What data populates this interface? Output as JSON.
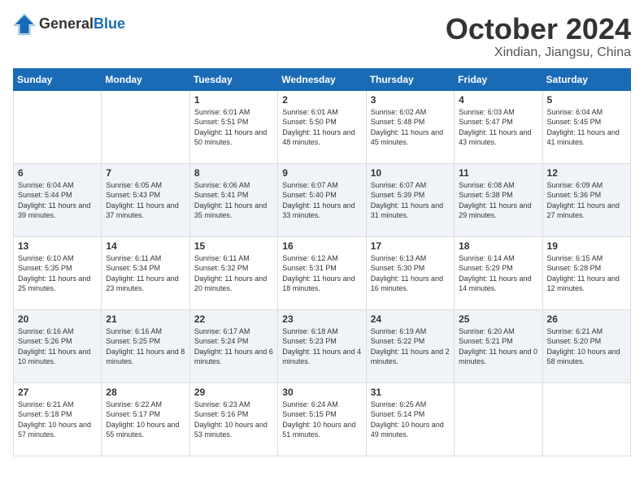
{
  "header": {
    "logo_general": "General",
    "logo_blue": "Blue",
    "month_title": "October 2024",
    "location": "Xindian, Jiangsu, China"
  },
  "weekdays": [
    "Sunday",
    "Monday",
    "Tuesday",
    "Wednesday",
    "Thursday",
    "Friday",
    "Saturday"
  ],
  "weeks": [
    [
      {
        "day": "",
        "sunrise": "",
        "sunset": "",
        "daylight": ""
      },
      {
        "day": "",
        "sunrise": "",
        "sunset": "",
        "daylight": ""
      },
      {
        "day": "1",
        "sunrise": "Sunrise: 6:01 AM",
        "sunset": "Sunset: 5:51 PM",
        "daylight": "Daylight: 11 hours and 50 minutes."
      },
      {
        "day": "2",
        "sunrise": "Sunrise: 6:01 AM",
        "sunset": "Sunset: 5:50 PM",
        "daylight": "Daylight: 11 hours and 48 minutes."
      },
      {
        "day": "3",
        "sunrise": "Sunrise: 6:02 AM",
        "sunset": "Sunset: 5:48 PM",
        "daylight": "Daylight: 11 hours and 45 minutes."
      },
      {
        "day": "4",
        "sunrise": "Sunrise: 6:03 AM",
        "sunset": "Sunset: 5:47 PM",
        "daylight": "Daylight: 11 hours and 43 minutes."
      },
      {
        "day": "5",
        "sunrise": "Sunrise: 6:04 AM",
        "sunset": "Sunset: 5:45 PM",
        "daylight": "Daylight: 11 hours and 41 minutes."
      }
    ],
    [
      {
        "day": "6",
        "sunrise": "Sunrise: 6:04 AM",
        "sunset": "Sunset: 5:44 PM",
        "daylight": "Daylight: 11 hours and 39 minutes."
      },
      {
        "day": "7",
        "sunrise": "Sunrise: 6:05 AM",
        "sunset": "Sunset: 5:43 PM",
        "daylight": "Daylight: 11 hours and 37 minutes."
      },
      {
        "day": "8",
        "sunrise": "Sunrise: 6:06 AM",
        "sunset": "Sunset: 5:41 PM",
        "daylight": "Daylight: 11 hours and 35 minutes."
      },
      {
        "day": "9",
        "sunrise": "Sunrise: 6:07 AM",
        "sunset": "Sunset: 5:40 PM",
        "daylight": "Daylight: 11 hours and 33 minutes."
      },
      {
        "day": "10",
        "sunrise": "Sunrise: 6:07 AM",
        "sunset": "Sunset: 5:39 PM",
        "daylight": "Daylight: 11 hours and 31 minutes."
      },
      {
        "day": "11",
        "sunrise": "Sunrise: 6:08 AM",
        "sunset": "Sunset: 5:38 PM",
        "daylight": "Daylight: 11 hours and 29 minutes."
      },
      {
        "day": "12",
        "sunrise": "Sunrise: 6:09 AM",
        "sunset": "Sunset: 5:36 PM",
        "daylight": "Daylight: 11 hours and 27 minutes."
      }
    ],
    [
      {
        "day": "13",
        "sunrise": "Sunrise: 6:10 AM",
        "sunset": "Sunset: 5:35 PM",
        "daylight": "Daylight: 11 hours and 25 minutes."
      },
      {
        "day": "14",
        "sunrise": "Sunrise: 6:11 AM",
        "sunset": "Sunset: 5:34 PM",
        "daylight": "Daylight: 11 hours and 23 minutes."
      },
      {
        "day": "15",
        "sunrise": "Sunrise: 6:11 AM",
        "sunset": "Sunset: 5:32 PM",
        "daylight": "Daylight: 11 hours and 20 minutes."
      },
      {
        "day": "16",
        "sunrise": "Sunrise: 6:12 AM",
        "sunset": "Sunset: 5:31 PM",
        "daylight": "Daylight: 11 hours and 18 minutes."
      },
      {
        "day": "17",
        "sunrise": "Sunrise: 6:13 AM",
        "sunset": "Sunset: 5:30 PM",
        "daylight": "Daylight: 11 hours and 16 minutes."
      },
      {
        "day": "18",
        "sunrise": "Sunrise: 6:14 AM",
        "sunset": "Sunset: 5:29 PM",
        "daylight": "Daylight: 11 hours and 14 minutes."
      },
      {
        "day": "19",
        "sunrise": "Sunrise: 6:15 AM",
        "sunset": "Sunset: 5:28 PM",
        "daylight": "Daylight: 11 hours and 12 minutes."
      }
    ],
    [
      {
        "day": "20",
        "sunrise": "Sunrise: 6:16 AM",
        "sunset": "Sunset: 5:26 PM",
        "daylight": "Daylight: 11 hours and 10 minutes."
      },
      {
        "day": "21",
        "sunrise": "Sunrise: 6:16 AM",
        "sunset": "Sunset: 5:25 PM",
        "daylight": "Daylight: 11 hours and 8 minutes."
      },
      {
        "day": "22",
        "sunrise": "Sunrise: 6:17 AM",
        "sunset": "Sunset: 5:24 PM",
        "daylight": "Daylight: 11 hours and 6 minutes."
      },
      {
        "day": "23",
        "sunrise": "Sunrise: 6:18 AM",
        "sunset": "Sunset: 5:23 PM",
        "daylight": "Daylight: 11 hours and 4 minutes."
      },
      {
        "day": "24",
        "sunrise": "Sunrise: 6:19 AM",
        "sunset": "Sunset: 5:22 PM",
        "daylight": "Daylight: 11 hours and 2 minutes."
      },
      {
        "day": "25",
        "sunrise": "Sunrise: 6:20 AM",
        "sunset": "Sunset: 5:21 PM",
        "daylight": "Daylight: 11 hours and 0 minutes."
      },
      {
        "day": "26",
        "sunrise": "Sunrise: 6:21 AM",
        "sunset": "Sunset: 5:20 PM",
        "daylight": "Daylight: 10 hours and 58 minutes."
      }
    ],
    [
      {
        "day": "27",
        "sunrise": "Sunrise: 6:21 AM",
        "sunset": "Sunset: 5:18 PM",
        "daylight": "Daylight: 10 hours and 57 minutes."
      },
      {
        "day": "28",
        "sunrise": "Sunrise: 6:22 AM",
        "sunset": "Sunset: 5:17 PM",
        "daylight": "Daylight: 10 hours and 55 minutes."
      },
      {
        "day": "29",
        "sunrise": "Sunrise: 6:23 AM",
        "sunset": "Sunset: 5:16 PM",
        "daylight": "Daylight: 10 hours and 53 minutes."
      },
      {
        "day": "30",
        "sunrise": "Sunrise: 6:24 AM",
        "sunset": "Sunset: 5:15 PM",
        "daylight": "Daylight: 10 hours and 51 minutes."
      },
      {
        "day": "31",
        "sunrise": "Sunrise: 6:25 AM",
        "sunset": "Sunset: 5:14 PM",
        "daylight": "Daylight: 10 hours and 49 minutes."
      },
      {
        "day": "",
        "sunrise": "",
        "sunset": "",
        "daylight": ""
      },
      {
        "day": "",
        "sunrise": "",
        "sunset": "",
        "daylight": ""
      }
    ]
  ]
}
